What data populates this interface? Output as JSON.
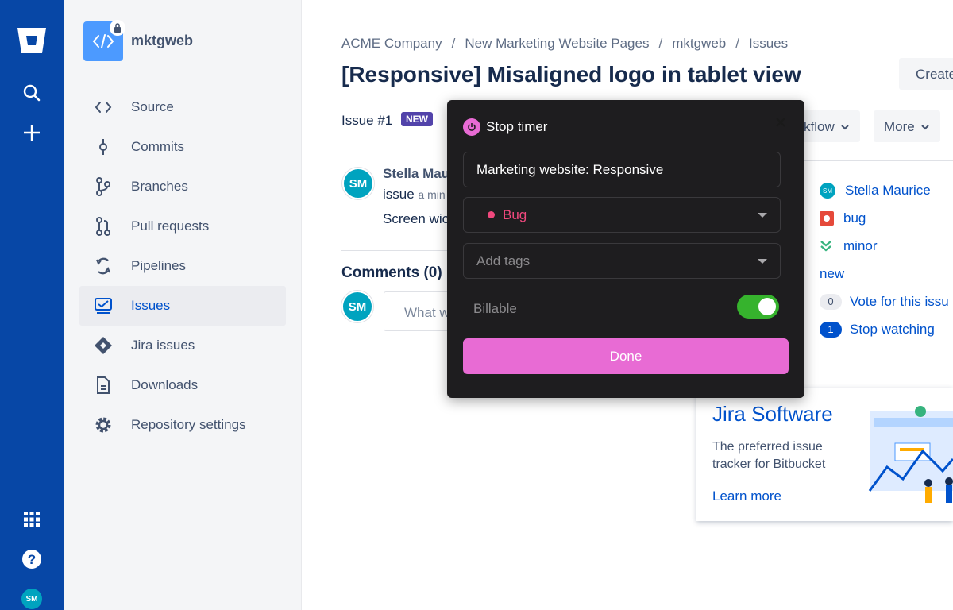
{
  "global_nav": {
    "icons": [
      "bitbucket-logo",
      "search-icon",
      "plus-icon",
      "app-switcher-icon",
      "help-icon"
    ],
    "avatar_initials": "SM"
  },
  "sidebar": {
    "repo_name": "mktgweb",
    "items": [
      {
        "label": "Source",
        "icon": "source-icon"
      },
      {
        "label": "Commits",
        "icon": "commits-icon"
      },
      {
        "label": "Branches",
        "icon": "branches-icon"
      },
      {
        "label": "Pull requests",
        "icon": "pull-requests-icon"
      },
      {
        "label": "Pipelines",
        "icon": "pipelines-icon"
      },
      {
        "label": "Issues",
        "icon": "issues-icon",
        "active": true
      },
      {
        "label": "Jira issues",
        "icon": "jira-icon"
      },
      {
        "label": "Downloads",
        "icon": "downloads-icon"
      },
      {
        "label": "Repository settings",
        "icon": "gear-icon"
      }
    ]
  },
  "breadcrumb": [
    "ACME Company",
    "New Marketing Website Pages",
    "mktgweb",
    "Issues"
  ],
  "breadcrumb_sep": "/",
  "issue": {
    "title": "[Responsive] Misaligned logo in tablet view",
    "id_label": "Issue #1",
    "status_badge": "NEW",
    "create_label": "Create",
    "workflow_label": "kflow",
    "more_label": "More",
    "author": "Stella Mau",
    "action_text": "issue",
    "action_time": "a min",
    "description": "Screen wic",
    "avatar_initials": "SM",
    "comments_heading": "Comments (0)",
    "comment_placeholder": "What w"
  },
  "side_panel": {
    "assignee_initials": "SM",
    "assignee": "Stella Maurice",
    "kind": "bug",
    "priority": "minor",
    "status": "new",
    "votes_count": "0",
    "votes_label": "Vote for this issu",
    "watchers_count": "1",
    "watch_label": "Stop watching"
  },
  "promo": {
    "title": "Jira Software",
    "text": "The preferred issue tracker for Bitbucket",
    "link": "Learn more"
  },
  "timer_modal": {
    "title": "Stop timer",
    "description_value": "Marketing website: Responsive",
    "project_value": "Bug",
    "tags_placeholder": "Add tags",
    "billable_label": "Billable",
    "billable_on": true,
    "done_label": "Done"
  },
  "colors": {
    "nav_bg": "#0747a6",
    "link": "#0052cc",
    "modal_bg": "#1e1d1f",
    "accent_pink": "#e86bd4",
    "bug_pink": "#f0487d",
    "toggle_green": "#36b32d"
  }
}
